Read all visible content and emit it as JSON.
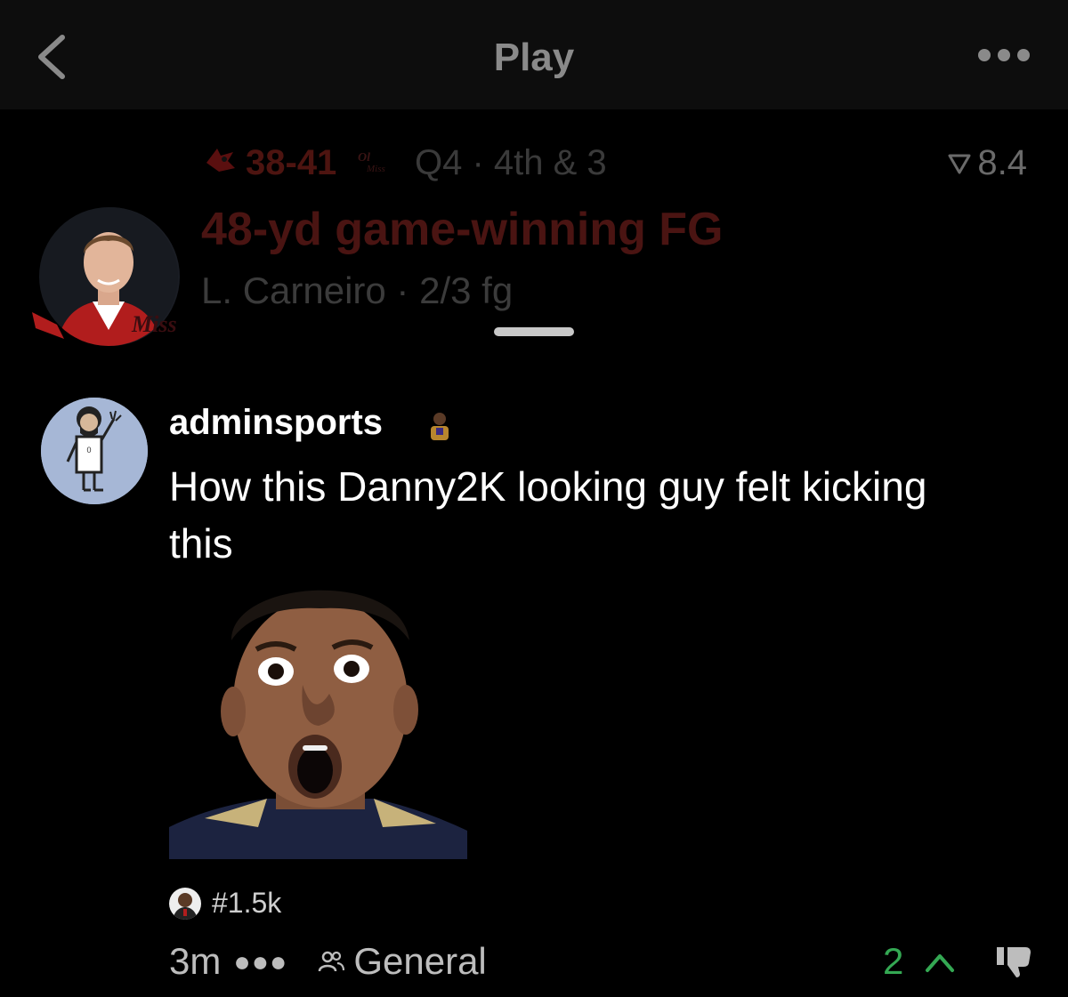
{
  "nav": {
    "title": "Play"
  },
  "play": {
    "score": "38-41",
    "quarter": "Q4 · 4th & 3",
    "rating": "8.4",
    "title": "48-yd game-winning FG",
    "subtitle": "L. Carneiro · 2/3 fg",
    "icons": {
      "left_team": "cardinal-logo-icon",
      "right_team": "ole-miss-logo-icon",
      "rating": "rating-flag-icon"
    },
    "colors": {
      "title": "#4a1412",
      "score": "#4d1410"
    }
  },
  "comment": {
    "username": "adminsports",
    "text": "How this Danny2K looking guy felt kicking this",
    "rank": "#1.5k",
    "time": "3m",
    "group": "General",
    "votes": "2",
    "colors": {
      "votes": "#34a853",
      "avatar_bg": "#a6b7d6"
    }
  }
}
